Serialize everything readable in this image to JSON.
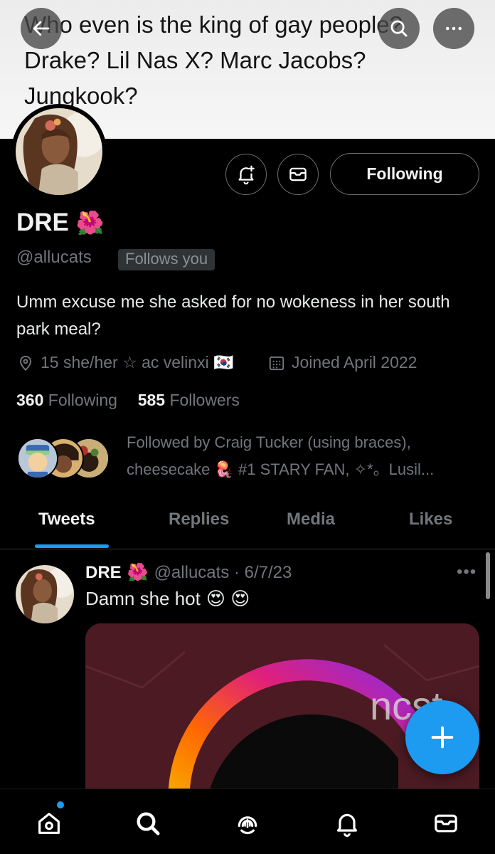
{
  "header": {
    "banner_text": "Who even is the king of gay people? Drake? Lil Nas X? Marc Jacobs? Jungkook?",
    "back_icon": "arrow-left-icon",
    "search_icon": "search-icon",
    "more_icon": "more-horizontal-icon"
  },
  "profile": {
    "display_name": "DRE",
    "name_emoji": "🌺",
    "handle": "@allucats",
    "follows_you_label": "Follows you",
    "follow_button_label": "Following",
    "bio": "Umm excuse me she asked for no wokeness in her south park meal?",
    "location": "15 she/her ☆ ac velinxi 🇰🇷",
    "joined": "Joined April 2022",
    "following_count": "360",
    "following_label": "Following",
    "followers_count": "585",
    "followers_label": "Followers",
    "followed_by_text": "Followed by Craig Tucker (using braces), cheesecake 🪼 #1 STARY FAN, ✧*。Lusil..."
  },
  "tabs": [
    {
      "label": "Tweets",
      "active": true
    },
    {
      "label": "Replies",
      "active": false
    },
    {
      "label": "Media",
      "active": false
    },
    {
      "label": "Likes",
      "active": false
    }
  ],
  "tweet": {
    "name": "DRE",
    "name_emoji": "🌺",
    "handle_date": "@allucats · 6/7/23",
    "text": "Damn she hot",
    "text_emojis": "😍 😍",
    "more_label": "•••"
  },
  "nav": {
    "items": [
      "home-icon",
      "search-icon",
      "spaces-icon",
      "notifications-icon",
      "messages-icon"
    ]
  },
  "colors": {
    "accent": "#1d9bf0",
    "background": "#000000",
    "muted_text": "#71767b"
  }
}
